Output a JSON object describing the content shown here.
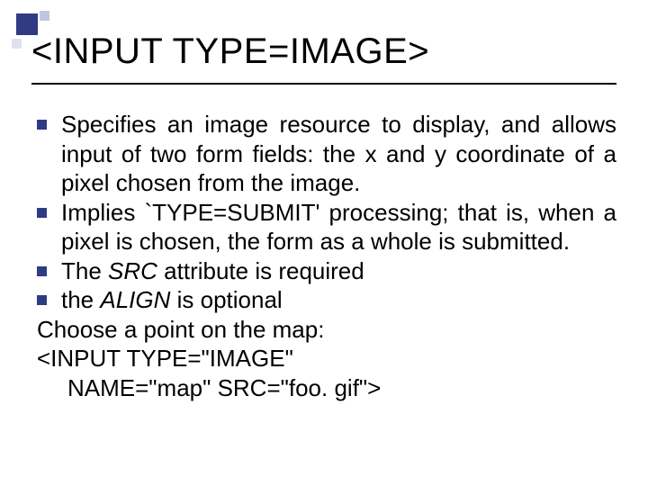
{
  "decoration": {
    "color_large": "#2f3b82",
    "color_small": "#bfc7e0"
  },
  "title": "<INPUT TYPE=IMAGE>",
  "bullets": [
    "Specifies an image resource to display, and allows input of two form fields: the x and y coordinate of a pixel chosen from the image.",
    "Implies `TYPE=SUBMIT' processing; that is, when a pixel is chosen, the form as a whole is submitted.",
    "The SRC attribute is required",
    "the ALIGN is optional"
  ],
  "trailing": [
    "Choose a point on the map:",
    "<INPUT TYPE=\"IMAGE\"",
    "NAME=\"map\"   SRC=\"foo. gif\">"
  ],
  "italic_words": {
    "src": "SRC",
    "align": "ALIGN"
  }
}
